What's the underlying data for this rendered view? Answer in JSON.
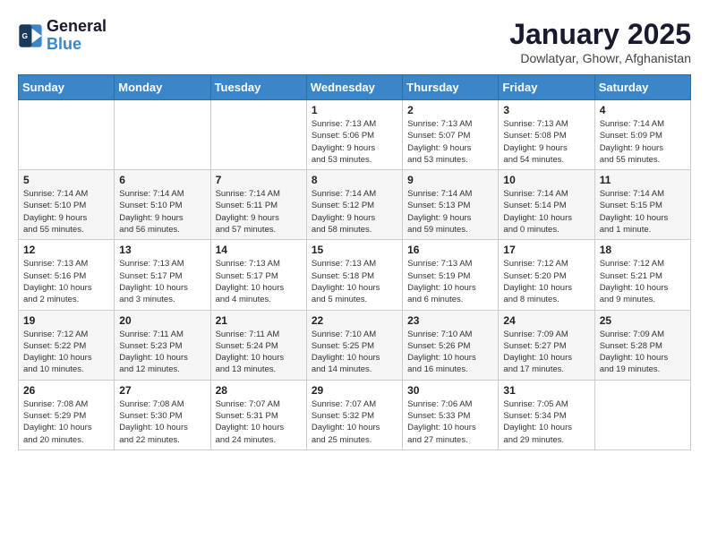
{
  "logo": {
    "line1": "General",
    "line2": "Blue"
  },
  "title": "January 2025",
  "subtitle": "Dowlatyar, Ghowr, Afghanistan",
  "weekdays": [
    "Sunday",
    "Monday",
    "Tuesday",
    "Wednesday",
    "Thursday",
    "Friday",
    "Saturday"
  ],
  "weeks": [
    [
      {
        "day": "",
        "detail": ""
      },
      {
        "day": "",
        "detail": ""
      },
      {
        "day": "",
        "detail": ""
      },
      {
        "day": "1",
        "detail": "Sunrise: 7:13 AM\nSunset: 5:06 PM\nDaylight: 9 hours\nand 53 minutes."
      },
      {
        "day": "2",
        "detail": "Sunrise: 7:13 AM\nSunset: 5:07 PM\nDaylight: 9 hours\nand 53 minutes."
      },
      {
        "day": "3",
        "detail": "Sunrise: 7:13 AM\nSunset: 5:08 PM\nDaylight: 9 hours\nand 54 minutes."
      },
      {
        "day": "4",
        "detail": "Sunrise: 7:14 AM\nSunset: 5:09 PM\nDaylight: 9 hours\nand 55 minutes."
      }
    ],
    [
      {
        "day": "5",
        "detail": "Sunrise: 7:14 AM\nSunset: 5:10 PM\nDaylight: 9 hours\nand 55 minutes."
      },
      {
        "day": "6",
        "detail": "Sunrise: 7:14 AM\nSunset: 5:10 PM\nDaylight: 9 hours\nand 56 minutes."
      },
      {
        "day": "7",
        "detail": "Sunrise: 7:14 AM\nSunset: 5:11 PM\nDaylight: 9 hours\nand 57 minutes."
      },
      {
        "day": "8",
        "detail": "Sunrise: 7:14 AM\nSunset: 5:12 PM\nDaylight: 9 hours\nand 58 minutes."
      },
      {
        "day": "9",
        "detail": "Sunrise: 7:14 AM\nSunset: 5:13 PM\nDaylight: 9 hours\nand 59 minutes."
      },
      {
        "day": "10",
        "detail": "Sunrise: 7:14 AM\nSunset: 5:14 PM\nDaylight: 10 hours\nand 0 minutes."
      },
      {
        "day": "11",
        "detail": "Sunrise: 7:14 AM\nSunset: 5:15 PM\nDaylight: 10 hours\nand 1 minute."
      }
    ],
    [
      {
        "day": "12",
        "detail": "Sunrise: 7:13 AM\nSunset: 5:16 PM\nDaylight: 10 hours\nand 2 minutes."
      },
      {
        "day": "13",
        "detail": "Sunrise: 7:13 AM\nSunset: 5:17 PM\nDaylight: 10 hours\nand 3 minutes."
      },
      {
        "day": "14",
        "detail": "Sunrise: 7:13 AM\nSunset: 5:17 PM\nDaylight: 10 hours\nand 4 minutes."
      },
      {
        "day": "15",
        "detail": "Sunrise: 7:13 AM\nSunset: 5:18 PM\nDaylight: 10 hours\nand 5 minutes."
      },
      {
        "day": "16",
        "detail": "Sunrise: 7:13 AM\nSunset: 5:19 PM\nDaylight: 10 hours\nand 6 minutes."
      },
      {
        "day": "17",
        "detail": "Sunrise: 7:12 AM\nSunset: 5:20 PM\nDaylight: 10 hours\nand 8 minutes."
      },
      {
        "day": "18",
        "detail": "Sunrise: 7:12 AM\nSunset: 5:21 PM\nDaylight: 10 hours\nand 9 minutes."
      }
    ],
    [
      {
        "day": "19",
        "detail": "Sunrise: 7:12 AM\nSunset: 5:22 PM\nDaylight: 10 hours\nand 10 minutes."
      },
      {
        "day": "20",
        "detail": "Sunrise: 7:11 AM\nSunset: 5:23 PM\nDaylight: 10 hours\nand 12 minutes."
      },
      {
        "day": "21",
        "detail": "Sunrise: 7:11 AM\nSunset: 5:24 PM\nDaylight: 10 hours\nand 13 minutes."
      },
      {
        "day": "22",
        "detail": "Sunrise: 7:10 AM\nSunset: 5:25 PM\nDaylight: 10 hours\nand 14 minutes."
      },
      {
        "day": "23",
        "detail": "Sunrise: 7:10 AM\nSunset: 5:26 PM\nDaylight: 10 hours\nand 16 minutes."
      },
      {
        "day": "24",
        "detail": "Sunrise: 7:09 AM\nSunset: 5:27 PM\nDaylight: 10 hours\nand 17 minutes."
      },
      {
        "day": "25",
        "detail": "Sunrise: 7:09 AM\nSunset: 5:28 PM\nDaylight: 10 hours\nand 19 minutes."
      }
    ],
    [
      {
        "day": "26",
        "detail": "Sunrise: 7:08 AM\nSunset: 5:29 PM\nDaylight: 10 hours\nand 20 minutes."
      },
      {
        "day": "27",
        "detail": "Sunrise: 7:08 AM\nSunset: 5:30 PM\nDaylight: 10 hours\nand 22 minutes."
      },
      {
        "day": "28",
        "detail": "Sunrise: 7:07 AM\nSunset: 5:31 PM\nDaylight: 10 hours\nand 24 minutes."
      },
      {
        "day": "29",
        "detail": "Sunrise: 7:07 AM\nSunset: 5:32 PM\nDaylight: 10 hours\nand 25 minutes."
      },
      {
        "day": "30",
        "detail": "Sunrise: 7:06 AM\nSunset: 5:33 PM\nDaylight: 10 hours\nand 27 minutes."
      },
      {
        "day": "31",
        "detail": "Sunrise: 7:05 AM\nSunset: 5:34 PM\nDaylight: 10 hours\nand 29 minutes."
      },
      {
        "day": "",
        "detail": ""
      }
    ]
  ]
}
